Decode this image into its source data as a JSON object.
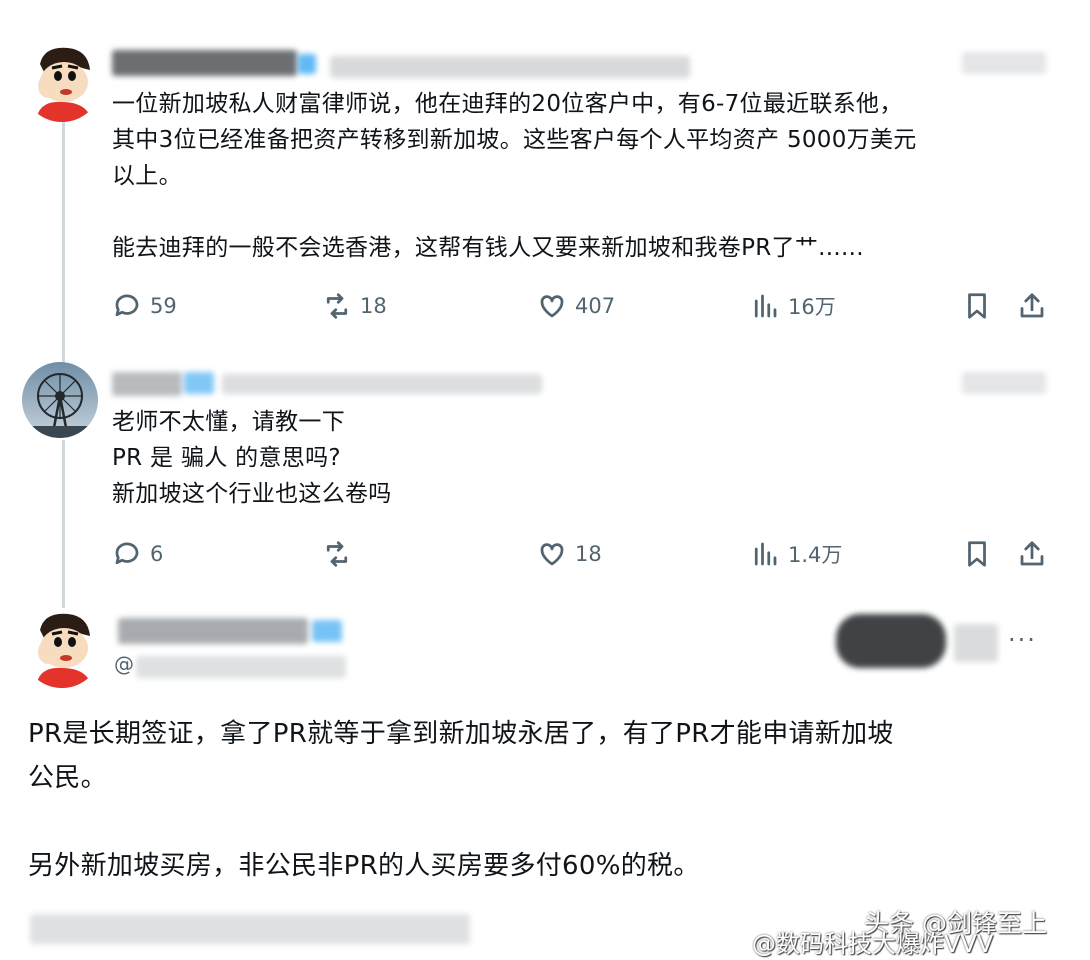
{
  "posts": [
    {
      "text": "一位新加坡私人财富律师说，他在迪拜的20位客户中，有6-7位最近联系他，\n其中3位已经准备把资产转移到新加坡。这些客户每个人平均资产 5000万美元\n以上。\n\n能去迪拜的一般不会选香港，这帮有钱人又要来新加坡和我卷PR了艹......",
      "replies": "59",
      "reposts": "18",
      "likes": "407",
      "views": "16万"
    },
    {
      "text": "老师不太懂，请教一下\nPR 是 骗人 的意思吗?\n新加坡这个行业也这么卷吗",
      "replies": "6",
      "reposts": "",
      "likes": "18",
      "views": "1.4万"
    },
    {
      "handle_prefix": "@",
      "text": "PR是长期签证，拿了PR就等于拿到新加坡永居了，有了PR才能申请新加坡\n公民。\n\n另外新加坡买房，非公民非PR的人买房要多付60%的税。"
    }
  ],
  "watermark": {
    "line1": "头条 @剑锋至上",
    "line2": "@数码科技大爆炸VVV"
  },
  "icons": [
    "reply-icon",
    "repost-icon",
    "like-icon",
    "views-icon",
    "bookmark-icon",
    "share-icon",
    "more-icon"
  ],
  "colors": {
    "text": "#0f1419",
    "secondary": "#536471",
    "thread_line": "#cfd9de"
  }
}
